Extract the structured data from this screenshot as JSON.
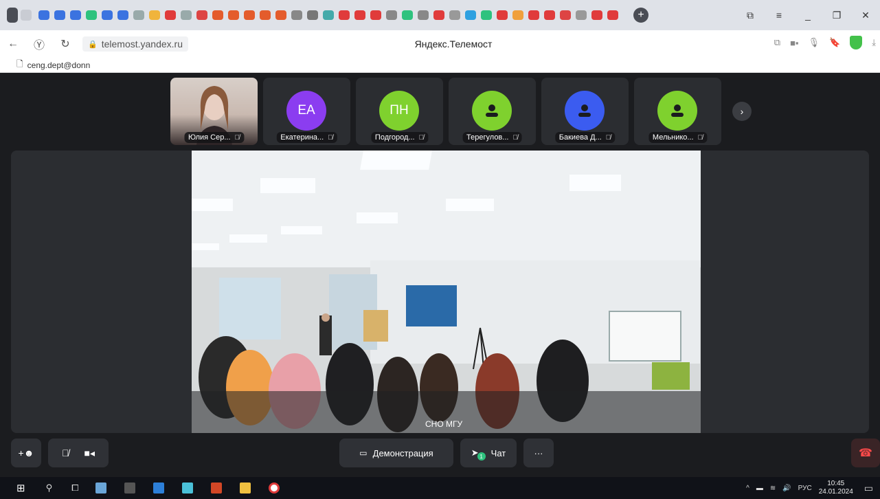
{
  "browser": {
    "url": "telemost.yandex.ru",
    "page_title": "Яндекс.Телемост",
    "bookmark": "ceng.dept@donn",
    "new_tab_symbol": "+",
    "tab_icon_colors": [
      "#3b73e0",
      "#3b73e0",
      "#3b73e0",
      "#2ec27e",
      "#3b73e0",
      "#3b73e0",
      "#9aa",
      "#f0b43c",
      "#e03b3b",
      "#9aa",
      "#d44",
      "#e45c2c",
      "#e45c2c",
      "#e45c2c",
      "#e45c2c",
      "#e45c2c",
      "#888",
      "#777",
      "#4aa",
      "#e03b3b",
      "#e03b3b",
      "#e03b3b",
      "#888",
      "#2ec27e",
      "#888",
      "#e03b3b",
      "#999",
      "#2ea0e0",
      "#2ec27e",
      "#e03b3b",
      "#f0a03c",
      "#e03b3b",
      "#e03b3b",
      "#d44",
      "#999",
      "#e03b3b",
      "#e03b3b"
    ]
  },
  "participants": [
    {
      "name": "Юлия Сер...",
      "type": "video"
    },
    {
      "name": "Екатерина...",
      "initials": "ЕА",
      "color": "#8b3df0"
    },
    {
      "name": "Подгород...",
      "initials": "ПН",
      "color": "#7fd12e"
    },
    {
      "name": "Терегулов...",
      "initials": "",
      "color": "#7fd12e",
      "icon": "user-icon"
    },
    {
      "name": "Бакиева Д...",
      "initials": "",
      "color": "#3b5cf0",
      "icon": "user-icon"
    },
    {
      "name": "Мельнико...",
      "initials": "",
      "color": "#7fd12e",
      "icon": "user-icon"
    }
  ],
  "main_video": {
    "speaker": "СНО МГУ"
  },
  "controls": {
    "screen_share_label": "Демонстрация",
    "chat_label": "Чат",
    "chat_unread": "1",
    "more_label": "···"
  },
  "tray": {
    "language": "РУС",
    "time": "10:45",
    "date": "24.01.2024"
  }
}
